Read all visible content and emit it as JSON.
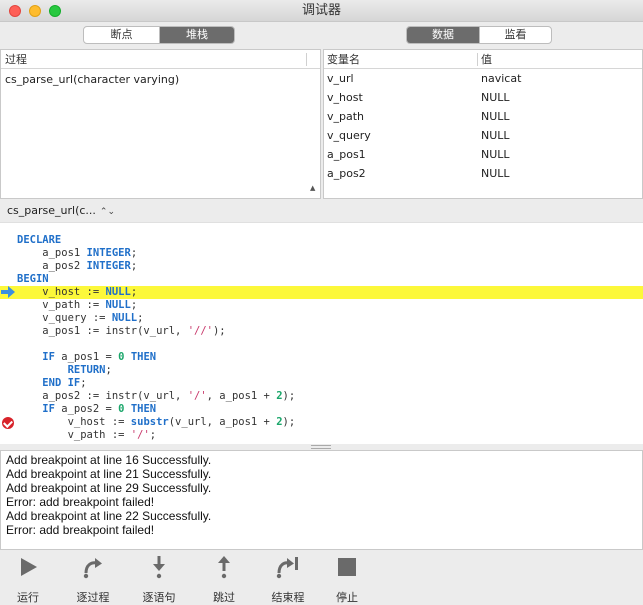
{
  "window": {
    "title": "调试器"
  },
  "left_tabs": [
    "断点",
    "堆栈"
  ],
  "right_tabs": [
    "数据",
    "监看"
  ],
  "stack": {
    "header": "过程",
    "items": [
      "cs_parse_url(character varying)"
    ]
  },
  "variables": {
    "header_name": "变量名",
    "header_value": "值",
    "rows": [
      {
        "name": "v_url",
        "value": "navicat"
      },
      {
        "name": "v_host",
        "value": "NULL"
      },
      {
        "name": "v_path",
        "value": "NULL"
      },
      {
        "name": "v_query",
        "value": "NULL"
      },
      {
        "name": "a_pos1",
        "value": "NULL"
      },
      {
        "name": "a_pos2",
        "value": "NULL"
      }
    ]
  },
  "selector": {
    "label": "cs_parse_url(c..."
  },
  "log": [
    "Add breakpoint at line 16 Successfully.",
    "Add breakpoint at line 21 Successfully.",
    "Add breakpoint at line 29 Successfully.",
    "Error: add breakpoint failed!",
    "Add breakpoint at line 22 Successfully.",
    "Error: add breakpoint failed!"
  ],
  "toolbar": {
    "run": "运行",
    "step_over": "逐过程",
    "step_into": "逐语句",
    "step_out": "跳过",
    "finish": "结束程",
    "stop": "停止"
  },
  "colors": {
    "highlight": "#fcf83a",
    "keyword": "#1f6fc9",
    "number": "#1aa66a",
    "string": "#c8386b",
    "breakpoint": "#d8232a"
  }
}
